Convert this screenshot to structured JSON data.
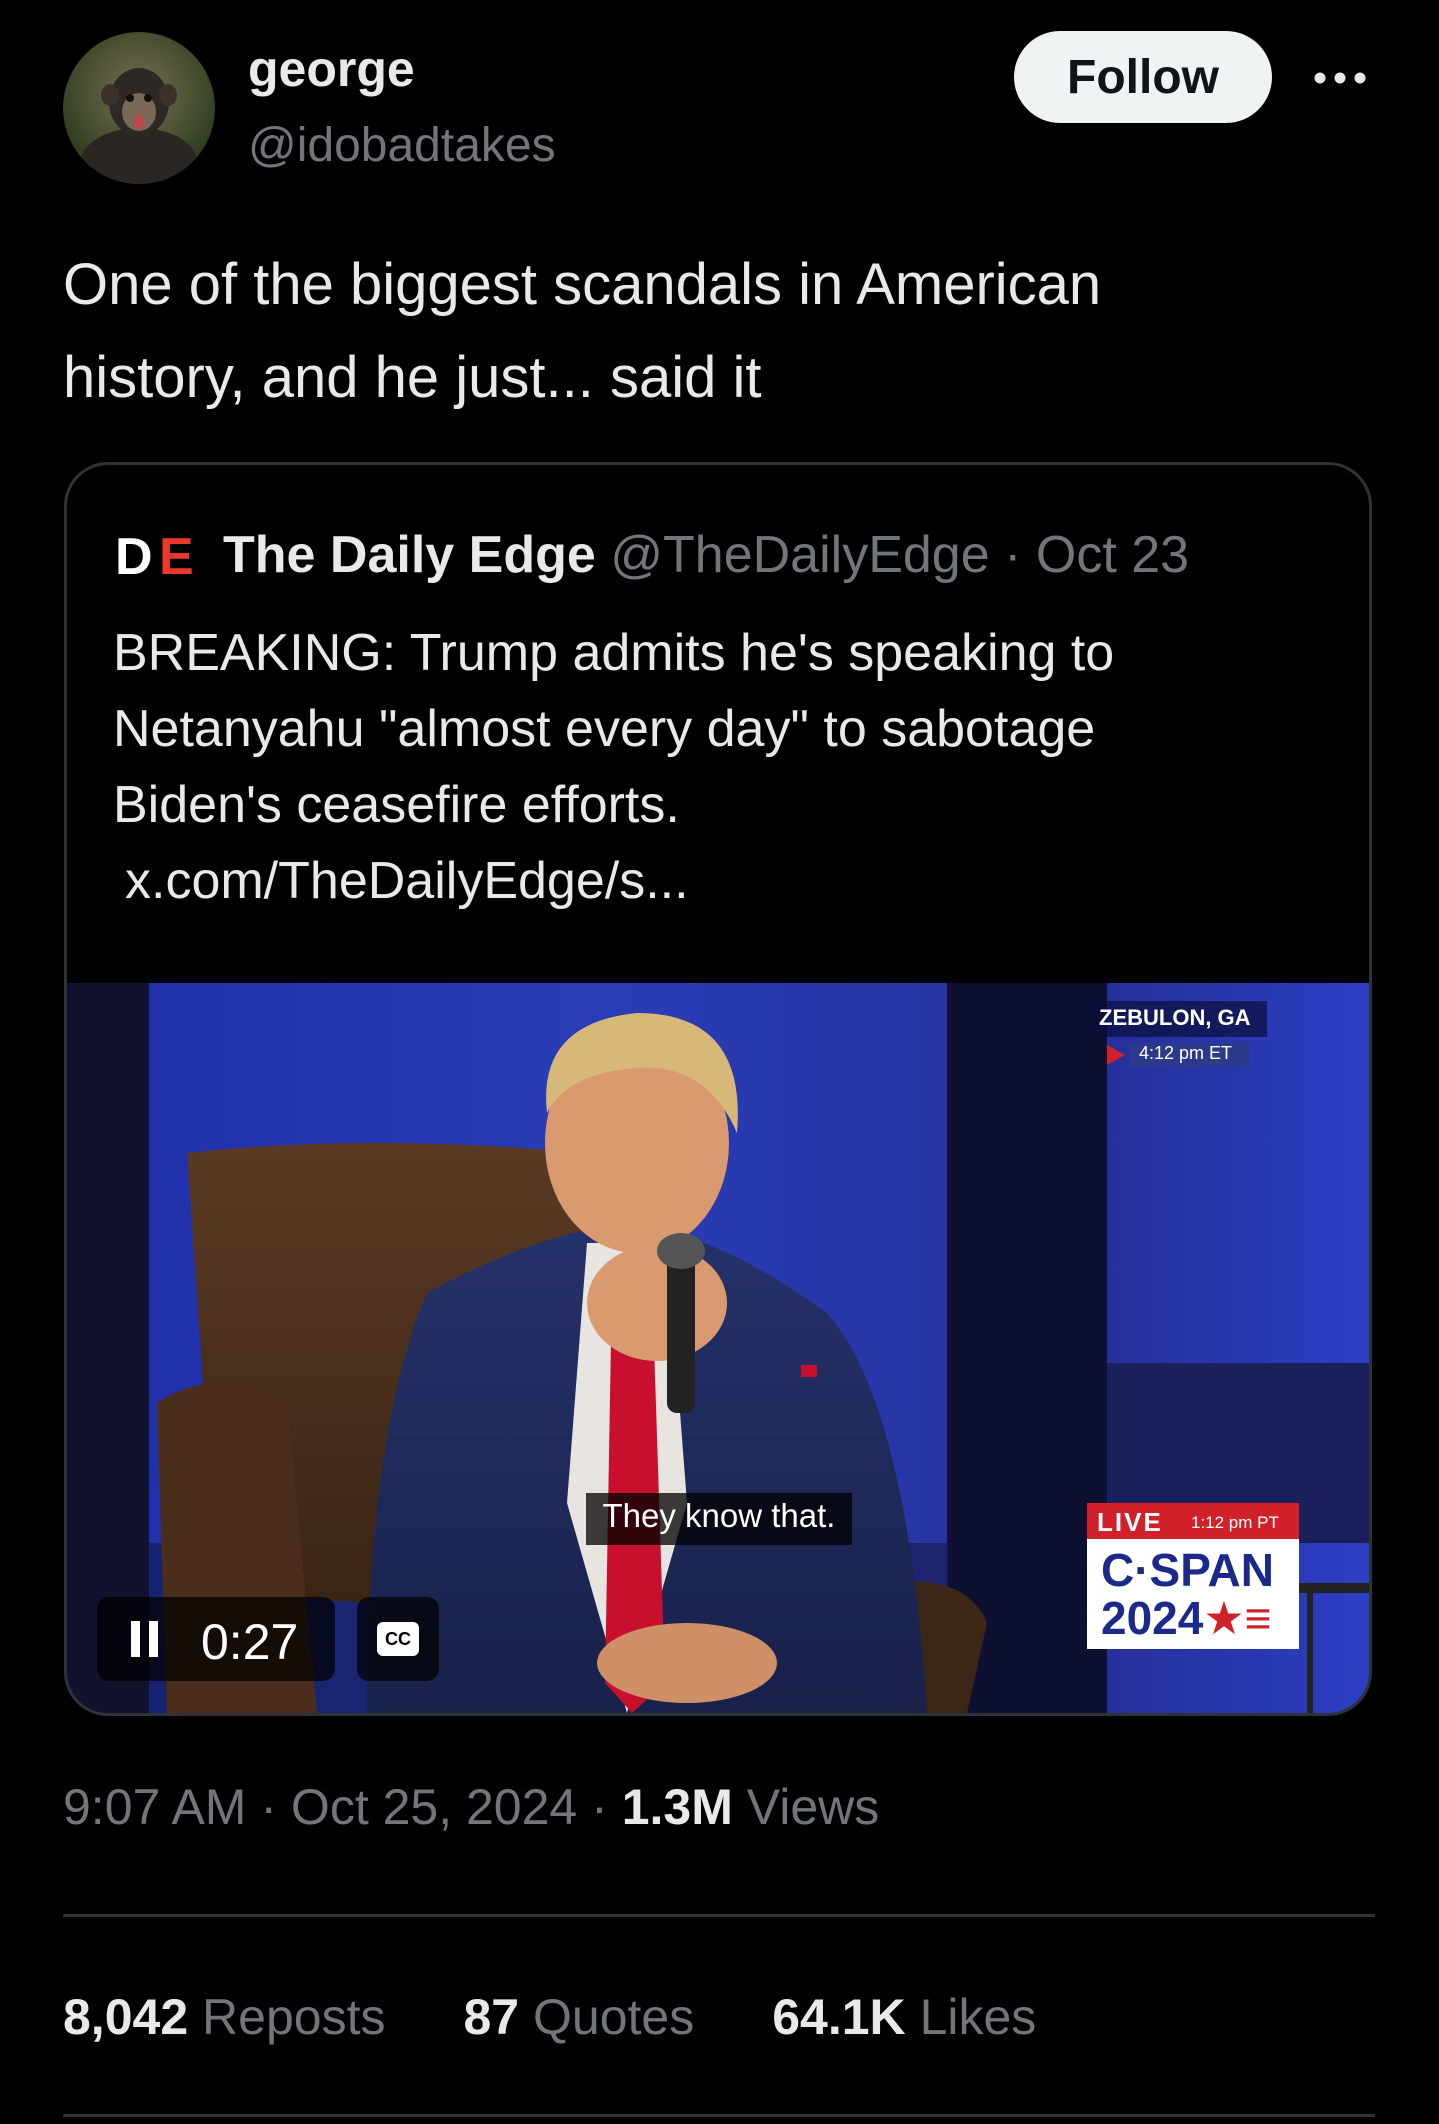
{
  "author": {
    "display_name": "george",
    "handle": "@idobadtakes",
    "avatar_icon": "monkey-avatar-icon"
  },
  "actions": {
    "follow_label": "Follow",
    "more_icon": "ellipsis-icon"
  },
  "tweet": {
    "text_line1": "One of the biggest scandals in American",
    "text_line2": "history, and he just... said it"
  },
  "quote": {
    "logo_text": "DE",
    "name": "The Daily Edge",
    "handle": "@TheDailyEdge",
    "separator": "·",
    "date": "Oct 23",
    "text_line1": "BREAKING: Trump admits he's speaking to",
    "text_line2": "Netanyahu \"almost every day\" to sabotage",
    "text_line3": "Biden's ceasefire efforts.",
    "link": "x.com/TheDailyEdge/s..."
  },
  "video": {
    "location": "ZEBULON, GA",
    "location_time": "4:12 pm ET",
    "caption": "They know that.",
    "live_label": "LIVE",
    "live_time": "1:12 pm PT",
    "network_line1": "C·SPAN",
    "network_line2": "2024",
    "elapsed": "0:27",
    "pause_icon": "pause-icon",
    "cc_label": "CC"
  },
  "meta": {
    "time": "9:07 AM",
    "separator": "·",
    "date": "Oct 25, 2024",
    "views_count": "1.3M",
    "views_label": "Views"
  },
  "stats": {
    "reposts_count": "8,042",
    "reposts_label": "Reposts",
    "quotes_count": "87",
    "quotes_label": "Quotes",
    "likes_count": "64.1K",
    "likes_label": "Likes"
  },
  "colors": {
    "background": "#000000",
    "text_primary": "#e7e9ea",
    "text_secondary": "#71767b",
    "border": "#2f3336",
    "follow_bg": "#eff3f4",
    "cspan_red": "#d0202a",
    "tie_red": "#c8102e"
  }
}
